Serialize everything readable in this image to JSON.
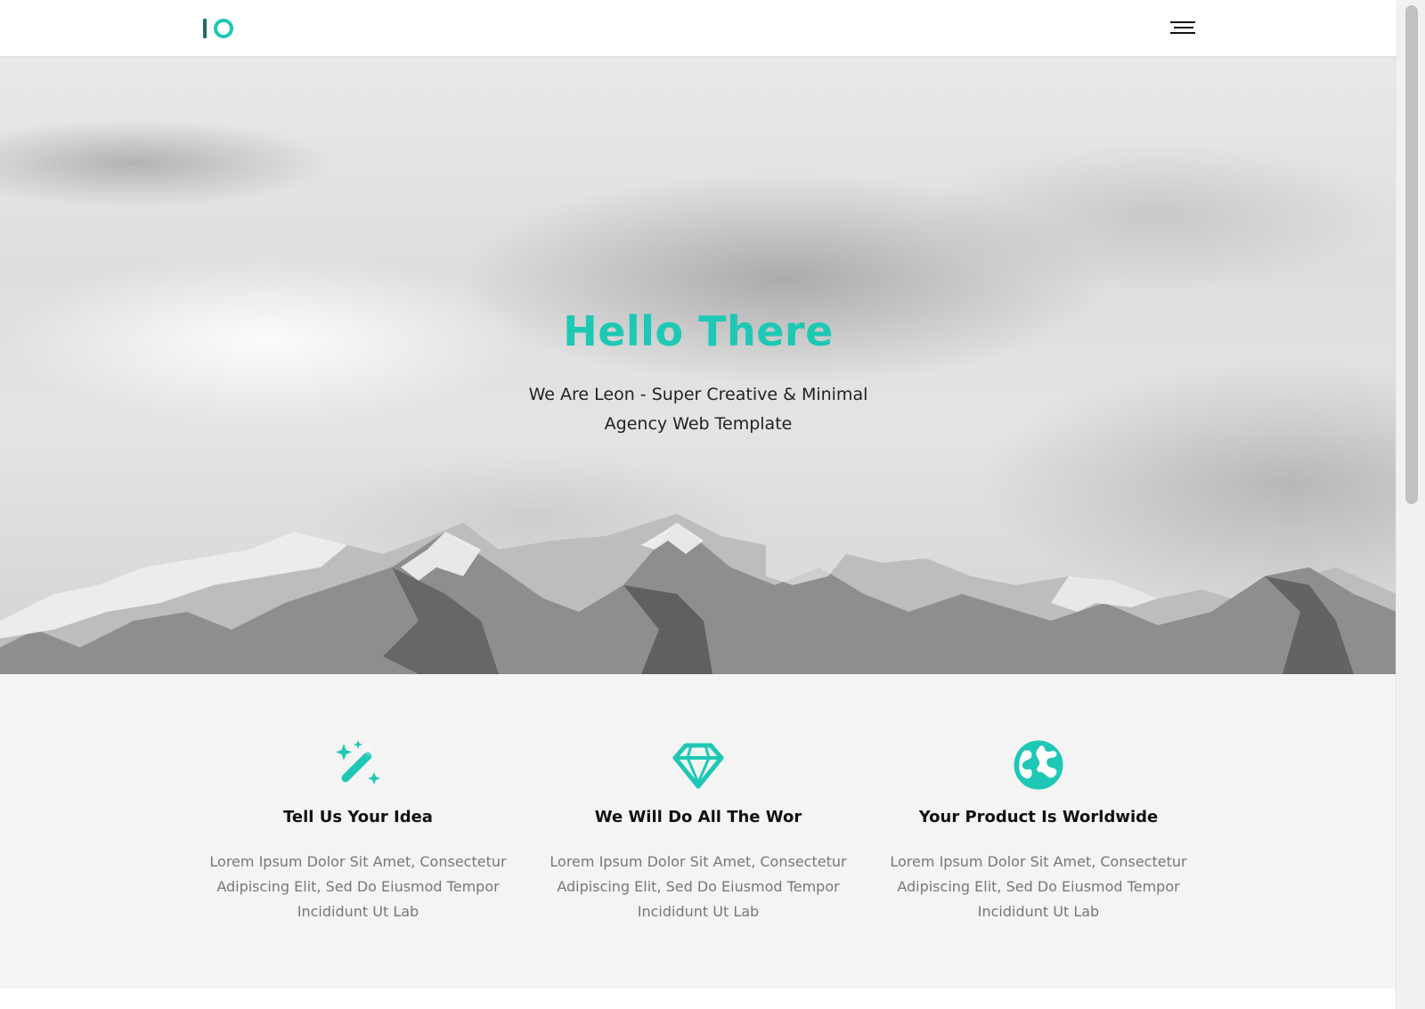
{
  "brand": {
    "logo_icon": "io-logo",
    "accent_color": "#1ec8b4",
    "logo_dark_color": "#1a6f6a"
  },
  "header": {
    "menu_icon": "hamburger-menu-icon"
  },
  "hero": {
    "title": "Hello There",
    "subtitle": "We Are Leon - Super Creative & Minimal Agency Web Template"
  },
  "features": [
    {
      "icon": "magic-wand-icon",
      "title": "Tell Us Your Idea",
      "text": "Lorem Ipsum Dolor Sit Amet, Consectetur Adipiscing Elit, Sed Do Eiusmod Tempor Incididunt Ut Lab"
    },
    {
      "icon": "diamond-icon",
      "title": "We Will Do All The Wor",
      "text": "Lorem Ipsum Dolor Sit Amet, Consectetur Adipiscing Elit, Sed Do Eiusmod Tempor Incididunt Ut Lab"
    },
    {
      "icon": "globe-icon",
      "title": "Your Product Is Worldwide",
      "text": "Lorem Ipsum Dolor Sit Amet, Consectetur Adipiscing Elit, Sed Do Eiusmod Tempor Incididunt Ut Lab"
    }
  ]
}
